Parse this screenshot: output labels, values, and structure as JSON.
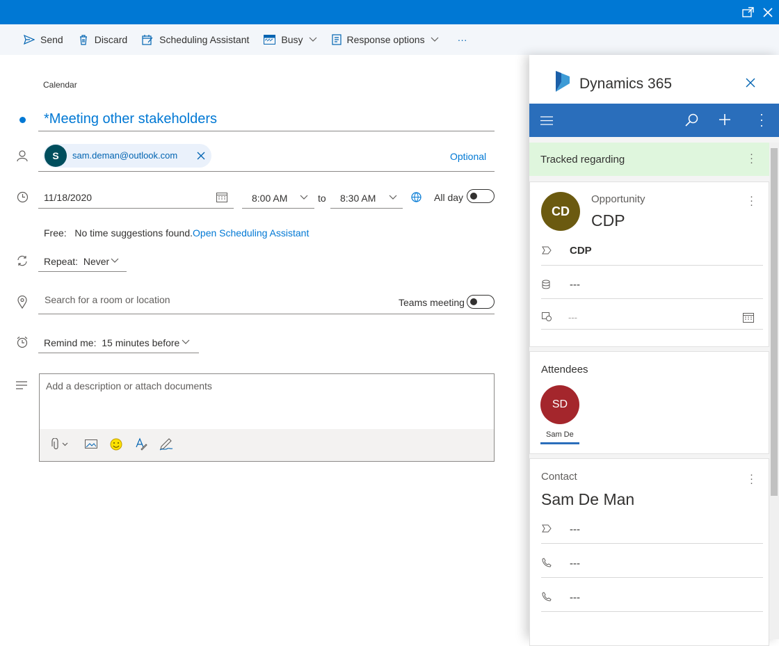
{
  "toolbar": {
    "send": "Send",
    "discard": "Discard",
    "scheduling_assistant": "Scheduling Assistant",
    "busy": "Busy",
    "response_options": "Response options",
    "more": "···"
  },
  "form": {
    "calendar_label": "Calendar",
    "title": "*Meeting other stakeholders",
    "attendee_initial": "S",
    "attendee_email": "sam.deman@outlook.com",
    "optional": "Optional",
    "date": "11/18/2020",
    "start_time": "8:00 AM",
    "to": "to",
    "end_time": "8:30 AM",
    "all_day": "All day",
    "free_label": "Free:",
    "free_text": "No time suggestions found.",
    "scheduling_link": "Open Scheduling Assistant",
    "repeat": "Repeat:",
    "repeat_value": "Never",
    "location_placeholder": "Search for a room or location",
    "teams_meeting": "Teams meeting",
    "remind": "Remind me:",
    "remind_value": "15 minutes before",
    "description_placeholder": "Add a description or attach documents"
  },
  "panel": {
    "app_name": "Dynamics 365",
    "banner": "Tracked regarding",
    "opportunity": {
      "type": "Opportunity",
      "initials": "CD",
      "name": "CDP",
      "field1": "CDP",
      "field2": "---",
      "field3": "---"
    },
    "attendees": {
      "heading": "Attendees",
      "initials": "SD",
      "name": "Sam De"
    },
    "contact": {
      "type": "Contact",
      "name": "Sam De Man",
      "field1": "---",
      "field2": "---",
      "field3": "---"
    }
  },
  "colors": {
    "accent": "#0078d4",
    "panel_nav": "#2a6ebb",
    "banner": "#dff6dd",
    "cd_avatar": "#6b5a10",
    "sd_avatar": "#a4262c",
    "attendee_avatar": "#004e5d"
  }
}
